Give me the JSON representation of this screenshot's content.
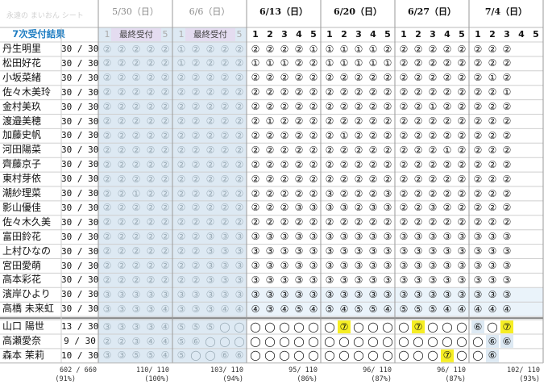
{
  "watermark": "永遠の まいおん シート",
  "result_title": "7次受付結果",
  "final_label": "最終受付",
  "dates": [
    {
      "label": "5/30（日）",
      "state": "past",
      "total": "110/ 110",
      "pct": "(100%)"
    },
    {
      "label": "6/6（日）",
      "state": "past",
      "total": "103/ 110",
      "pct": "(94%)"
    },
    {
      "label": "6/13（日）",
      "state": "current",
      "total": "95/ 110",
      "pct": "(86%)"
    },
    {
      "label": "6/20（日）",
      "state": "current",
      "total": "96/ 110",
      "pct": "(87%)"
    },
    {
      "label": "6/27（日）",
      "state": "current",
      "total": "96/ 110",
      "pct": "(87%)"
    },
    {
      "label": "7/4（日）",
      "state": "current",
      "total": "102/ 110",
      "pct": "(93%)"
    }
  ],
  "slot_numbers": [
    "1",
    "2",
    "3",
    "4",
    "5"
  ],
  "grand_total": "602 / 660",
  "grand_pct": "(91%)",
  "members": [
    {
      "name": "丹生明里",
      "score": "30 / 30",
      "cells": "2222212222222211111222222222"
    },
    {
      "name": "松田好花",
      "score": "30 / 30",
      "cells": "2222212222111221111122222222"
    },
    {
      "name": "小坂菜緒",
      "score": "30 / 30",
      "cells": "2222222222222222222222222212"
    },
    {
      "name": "佐々木美玲",
      "score": "30 / 30",
      "cells": "2222222222222222222222222221"
    },
    {
      "name": "金村美玖",
      "score": "30 / 30",
      "cells": "2222222222222222222222122222"
    },
    {
      "name": "渡邉美穂",
      "score": "30 / 30",
      "cells": "2222222222212222222222222222"
    },
    {
      "name": "加藤史帆",
      "score": "30 / 30",
      "cells": "2222222222222222122222222222"
    },
    {
      "name": "河田陽菜",
      "score": "30 / 30",
      "cells": "2222222222222222222222212222"
    },
    {
      "name": "齊藤京子",
      "score": "30 / 30",
      "cells": "2222222222222222222222222222"
    },
    {
      "name": "東村芽依",
      "score": "30 / 30",
      "cells": "2222222222222222222222222222"
    },
    {
      "name": "潮紗理菜",
      "score": "30 / 30",
      "cells": "2212222222222223222322222222"
    },
    {
      "name": "影山優佳",
      "score": "30 / 30",
      "cells": "2222222222222333323322322222"
    },
    {
      "name": "佐々木久美",
      "score": "30 / 30",
      "cells": "2222222222222222222222222222"
    },
    {
      "name": "富田鈴花",
      "score": "30 / 30",
      "cells": "2222222333333333333333333333"
    },
    {
      "name": "上村ひなの",
      "score": "30 / 30",
      "cells": "2222222333333333333333333333"
    },
    {
      "name": "宮田愛萌",
      "score": "30 / 30",
      "cells": "2222222333333333333333333333"
    },
    {
      "name": "高本彩花",
      "score": "30 / 30",
      "cells": "2222222333333333333333333333"
    },
    {
      "name": "濱岸ひより",
      "score": "30 / 30",
      "cells": "3333333333333333333333333333"
    },
    {
      "name": "高橋 未来虹",
      "score": "30 / 30",
      "cells": "3333433344434545455455544444"
    }
  ],
  "bottom_members": [
    {
      "name": "山口 陽世",
      "score": "13 / 30",
      "cells": "3333455500000000700007000607"
    },
    {
      "name": "高瀬愛奈",
      "score": "9 / 30",
      "cells": "2234456000000000000000000066"
    },
    {
      "name": "森本 茉莉",
      "score": "10 / 30",
      "cells": "335545006600000000000007006"
    }
  ]
}
